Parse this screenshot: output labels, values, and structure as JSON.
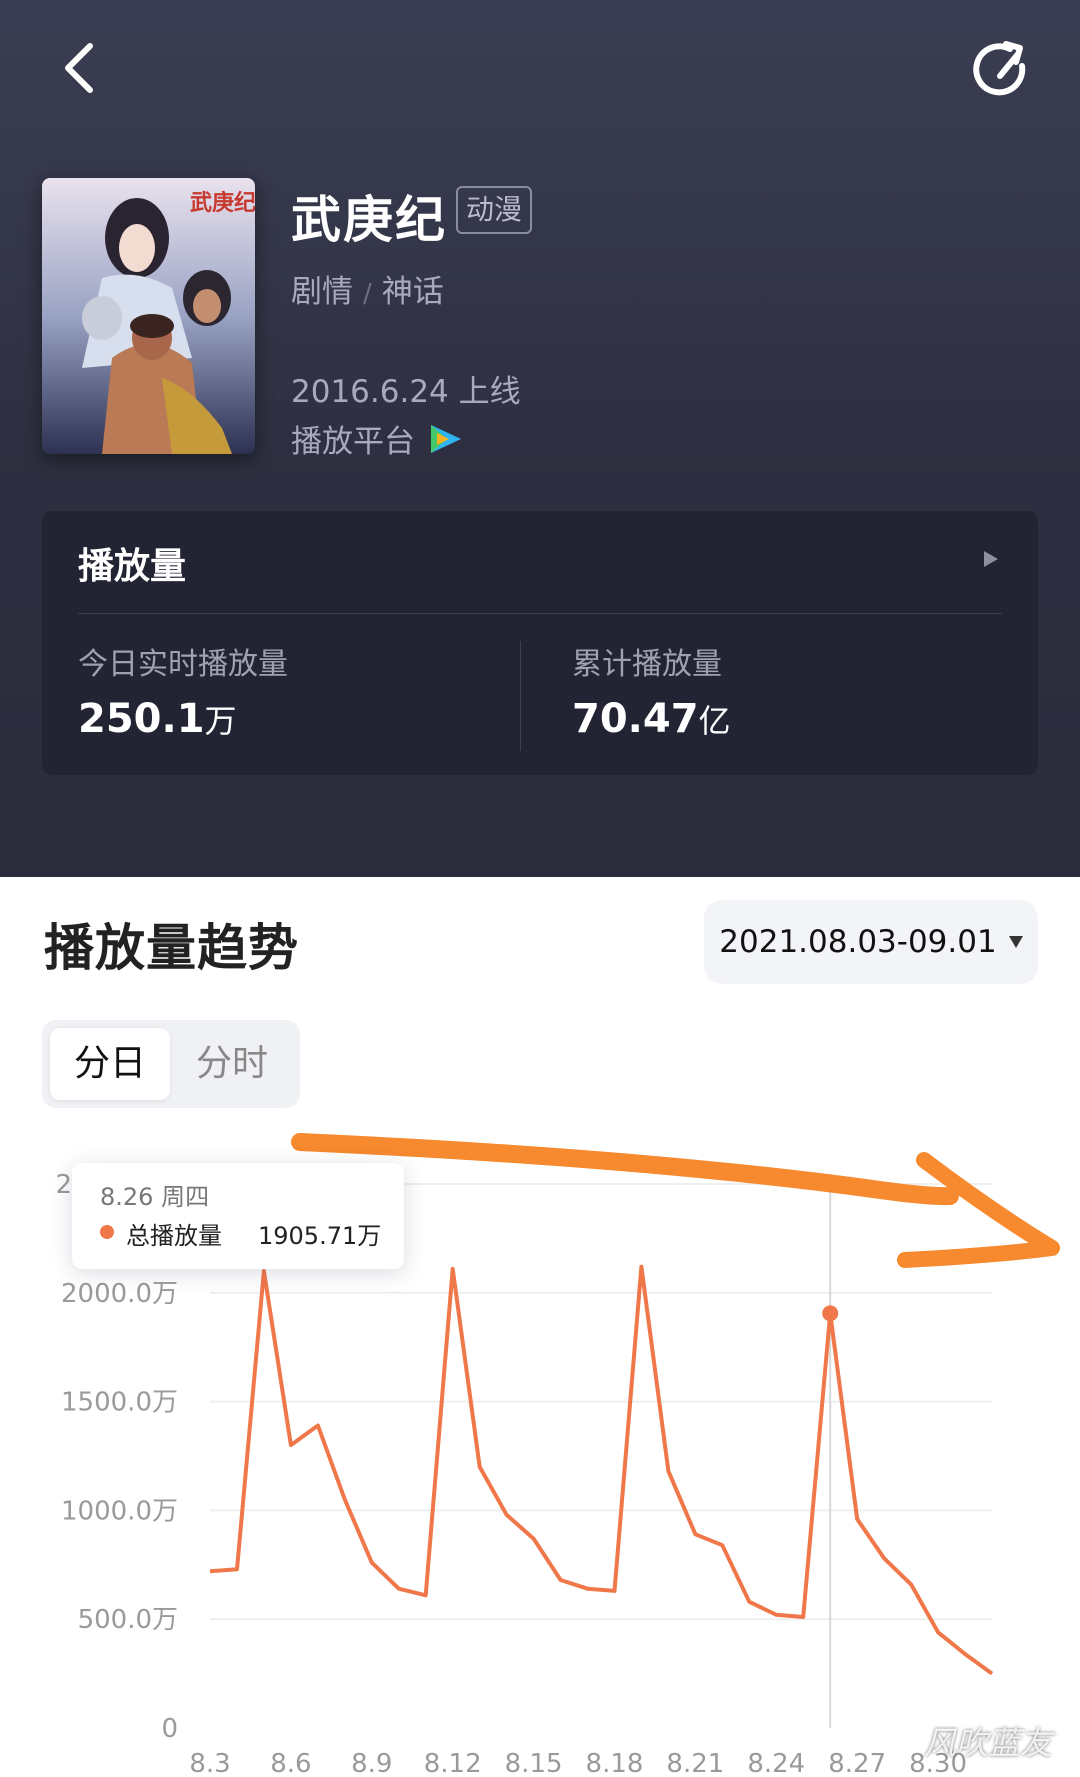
{
  "header": {
    "back_icon": "chevron-left-icon",
    "share_icon": "share-refresh-icon"
  },
  "show": {
    "title": "武庚纪",
    "badge": "动漫",
    "genres": [
      "剧情",
      "神话"
    ],
    "genre_sep": "/",
    "release": "2016.6.24 上线",
    "platform_label": "播放平台",
    "platform_icon": "tencent-video-icon"
  },
  "card": {
    "title": "播放量",
    "today_label": "今日实时播放量",
    "today_value": "250.1",
    "today_unit": "万",
    "total_label": "累计播放量",
    "total_value": "70.47",
    "total_unit": "亿"
  },
  "trend": {
    "title": "播放量趋势",
    "date_range": "2021.08.03-09.01",
    "tabs": [
      "分日",
      "分时"
    ],
    "active_tab": "分日"
  },
  "tooltip": {
    "date": "8.26 周四",
    "series": "总播放量",
    "value": "1905.71万"
  },
  "colors": {
    "line": "#f0774a",
    "annotation_arrow": "#f7892e"
  },
  "chart_data": {
    "type": "line",
    "x": [
      "8.3",
      "8.4",
      "8.5",
      "8.6",
      "8.7",
      "8.8",
      "8.9",
      "8.10",
      "8.11",
      "8.12",
      "8.13",
      "8.14",
      "8.15",
      "8.16",
      "8.17",
      "8.18",
      "8.19",
      "8.20",
      "8.21",
      "8.22",
      "8.23",
      "8.24",
      "8.25",
      "8.26",
      "8.27",
      "8.28",
      "8.29",
      "8.30",
      "8.31",
      "9.1"
    ],
    "x_tick_labels": [
      "8.3",
      "8.6",
      "8.9",
      "8.12",
      "8.15",
      "8.18",
      "8.21",
      "8.24",
      "8.27",
      "8.30"
    ],
    "y_tick_labels": [
      "0",
      "500.0万",
      "1000.0万",
      "1500.0万",
      "2000.0万",
      "2"
    ],
    "ylim": [
      0,
      2500
    ],
    "series": [
      {
        "name": "总播放量",
        "values": [
          720,
          730,
          2100,
          1300,
          1390,
          1050,
          760,
          640,
          610,
          2110,
          1200,
          980,
          870,
          680,
          640,
          630,
          2120,
          1180,
          890,
          840,
          580,
          520,
          510,
          1905.71,
          960,
          780,
          660,
          440,
          340,
          250
        ]
      }
    ],
    "highlight_index": 23
  },
  "watermark": "风吹蓝友"
}
